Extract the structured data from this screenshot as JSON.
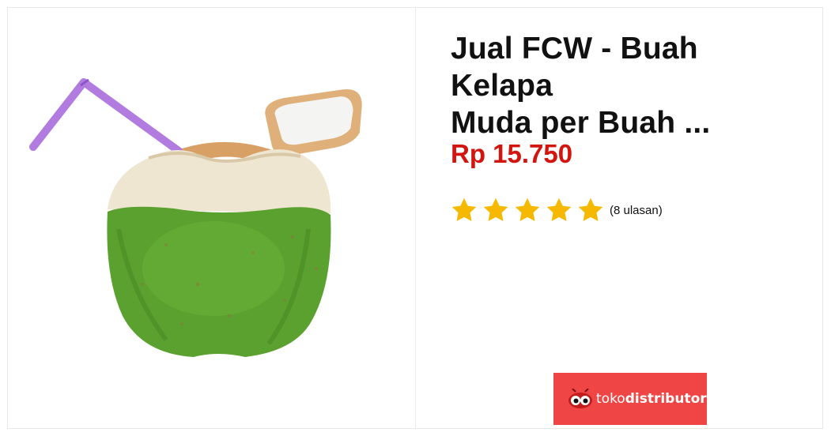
{
  "product": {
    "title_line1": "Jual FCW - Buah Kelapa",
    "title_line2": "Muda per Buah  ...",
    "price": "Rp 15.750",
    "rating_stars": 5,
    "review_count": "(8 ulasan)",
    "image_icon": "young-coconut-with-straw"
  },
  "brand": {
    "logo_text_part1": "toko",
    "logo_text_part2": "distributor",
    "logo_color": "#ef4545"
  },
  "colors": {
    "price": "#d2150f",
    "star": "#f7b900",
    "title": "#111111"
  }
}
